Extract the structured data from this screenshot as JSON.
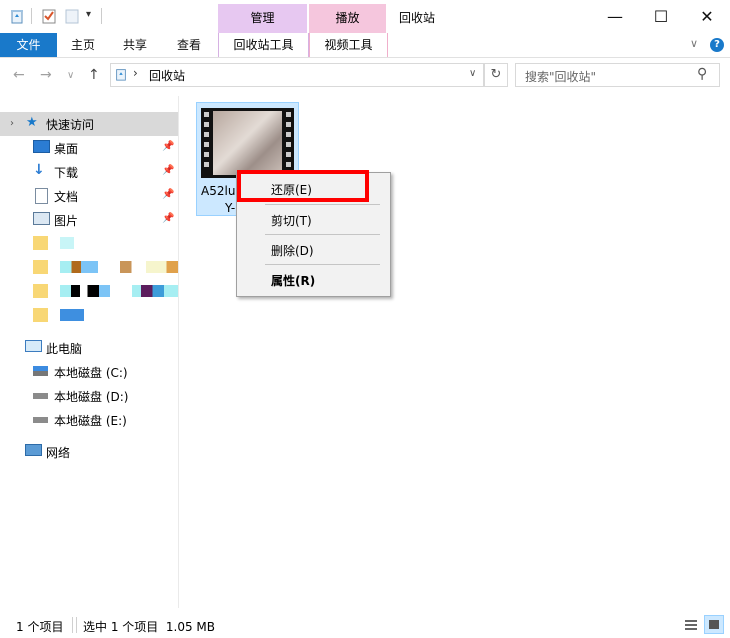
{
  "title_bar": {
    "window_title": "回收站",
    "context_tabs": [
      {
        "label": "管理",
        "color": "#e7c8f1"
      },
      {
        "label": "播放",
        "color": "#f5c6dd"
      }
    ],
    "controls": {
      "minimize": "—",
      "maximize": "☐",
      "close": "✕"
    }
  },
  "ribbon": {
    "tabs": [
      "文件",
      "主页",
      "共享",
      "查看"
    ],
    "context_subtabs": [
      "回收站工具",
      "视频工具"
    ],
    "help": "?",
    "collapse": "∨",
    "file_tab_color": "#1979ca"
  },
  "address": {
    "back": "←",
    "forward": "→",
    "recent": "∨",
    "up": "↑",
    "path": "回收站",
    "dropdown": "∨",
    "refresh": "↻",
    "search_placeholder": "搜索\"回收站\"",
    "search_icon": "⚲"
  },
  "nav": {
    "quick_access": "快速访问",
    "pinned": [
      {
        "label": "桌面",
        "icon": "desktop-icon"
      },
      {
        "label": "下载",
        "icon": "download-icon"
      },
      {
        "label": "文档",
        "icon": "document-icon"
      },
      {
        "label": "图片",
        "icon": "pictures-icon"
      }
    ],
    "this_pc": "此电脑",
    "drives": [
      "本地磁盘 (C:)",
      "本地磁盘 (D:)",
      "本地磁盘 (E:)"
    ],
    "network": "网络"
  },
  "file": {
    "name_line1": "A52lu",
    "name_line2": "Y-"
  },
  "context_menu": {
    "items": [
      "还原(E)",
      "剪切(T)",
      "删除(D)",
      "属性(R)"
    ],
    "highlight_color": "#ff0000"
  },
  "status": {
    "count": "1 个项目",
    "selected": "选中 1 个项目  1.05 MB"
  }
}
